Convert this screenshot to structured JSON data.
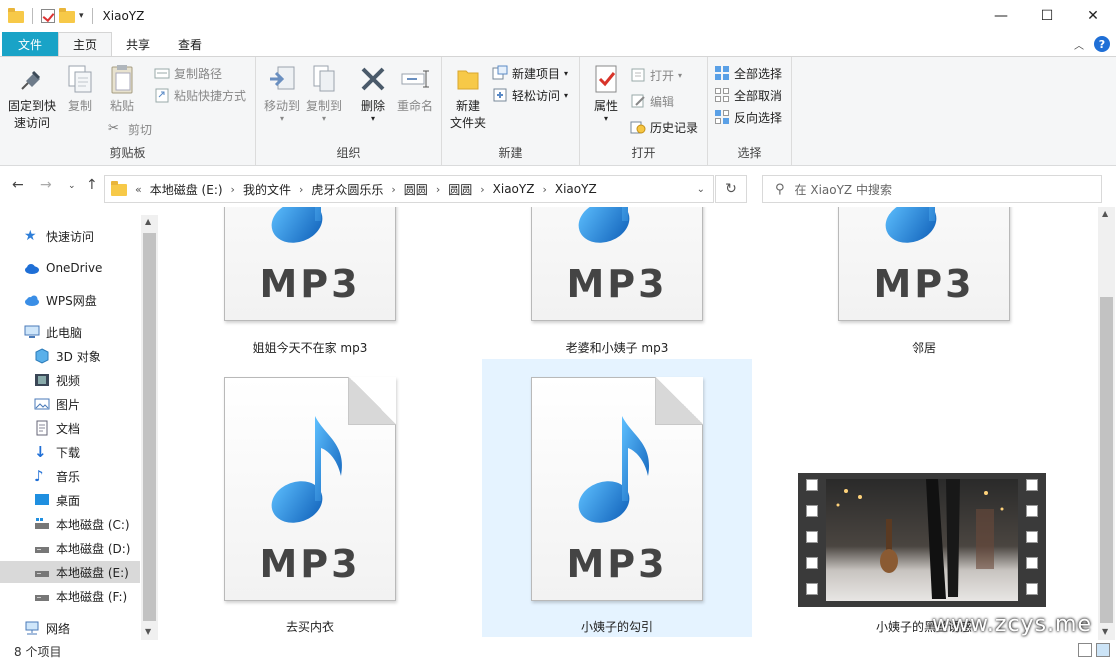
{
  "window": {
    "title": "XiaoYZ",
    "minimize": "—",
    "maximize": "☐",
    "close": "✕"
  },
  "ribbon_tabs": [
    {
      "label": "文件"
    },
    {
      "label": "主页"
    },
    {
      "label": "共享"
    },
    {
      "label": "查看"
    }
  ],
  "ribbon": {
    "clipboard": {
      "label": "剪贴板",
      "pin": "固定到快\n速访问",
      "copy": "复制",
      "paste": "粘贴",
      "copy_path": "复制路径",
      "paste_shortcut": "粘贴快捷方式",
      "cut": "剪切"
    },
    "organize": {
      "label": "组织",
      "move_to": "移动到",
      "copy_to": "复制到",
      "delete": "删除",
      "rename": "重命名"
    },
    "new": {
      "label": "新建",
      "new_folder": "新建\n文件夹",
      "new_item": "新建项目",
      "easy_access": "轻松访问"
    },
    "open": {
      "label": "打开",
      "properties": "属性",
      "open": "打开",
      "edit": "编辑",
      "history": "历史记录"
    },
    "select": {
      "label": "选择",
      "select_all": "全部选择",
      "select_none": "全部取消",
      "invert": "反向选择"
    }
  },
  "address": {
    "prefix": "«",
    "crumbs": [
      "本地磁盘 (E:)",
      "我的文件",
      "虎牙众圆乐乐",
      "圆圆",
      "圆圆",
      "XiaoYZ",
      "XiaoYZ"
    ],
    "search_placeholder": "在 XiaoYZ 中搜索"
  },
  "nav": {
    "items": [
      {
        "label": "快速访问"
      },
      {
        "label": "OneDrive"
      },
      {
        "label": "WPS网盘"
      },
      {
        "label": "此电脑"
      },
      {
        "label": "3D 对象"
      },
      {
        "label": "视频"
      },
      {
        "label": "图片"
      },
      {
        "label": "文档"
      },
      {
        "label": "下载"
      },
      {
        "label": "音乐"
      },
      {
        "label": "桌面"
      },
      {
        "label": "本地磁盘 (C:)"
      },
      {
        "label": "本地磁盘 (D:)"
      },
      {
        "label": "本地磁盘 (E:)"
      },
      {
        "label": "本地磁盘 (F:)"
      },
      {
        "label": "网络"
      }
    ]
  },
  "files": [
    {
      "name": "姐姐今天不在家 mp3",
      "badge": "MP3"
    },
    {
      "name": "老婆和小姨子 mp3",
      "badge": "MP3"
    },
    {
      "name": "邻居",
      "badge": "MP3"
    },
    {
      "name": "去买内衣",
      "badge": "MP3"
    },
    {
      "name": "小姨子的勾引",
      "badge": "MP3"
    },
    {
      "name": "小姨子的黑丝诱惑",
      "badge": ""
    }
  ],
  "status": {
    "count": "8 个项目"
  },
  "watermark": "www.zcys.me",
  "colors": {
    "accent": "#19a3c7",
    "selection": "#e5f3ff",
    "note_blue": "#1b7fd6"
  }
}
